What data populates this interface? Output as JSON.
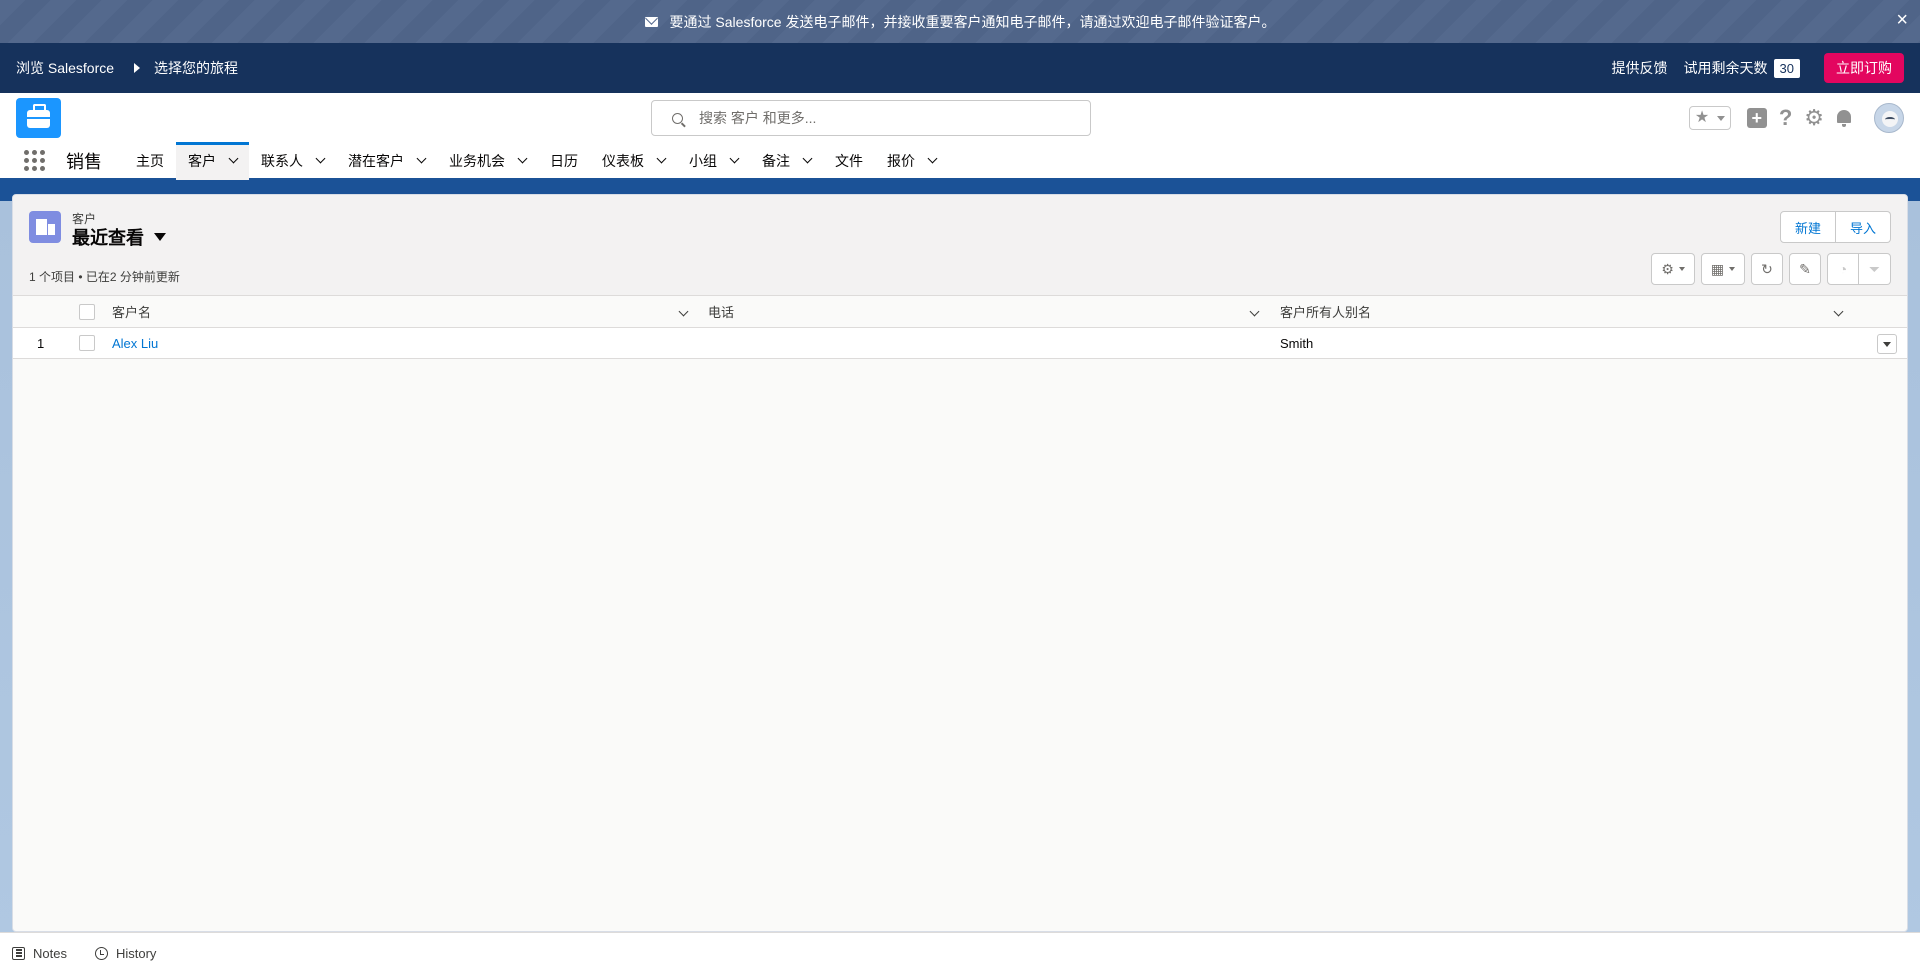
{
  "banner": {
    "message": "要通过 Salesforce 发送电子邮件，并接收重要客户通知电子邮件，请通过欢迎电子邮件验证客户。",
    "close_icon": "×"
  },
  "trialbar": {
    "explore": "浏览 Salesforce",
    "journey": "选择您的旅程",
    "feedback": "提供反馈",
    "days_label": "试用剩余天数",
    "days_value": "30",
    "buy": "立即订购"
  },
  "header": {
    "search_placeholder": "搜索 客户 和更多..."
  },
  "nav": {
    "app_name": "销售",
    "tabs": [
      {
        "label": "主页",
        "dropdown": false
      },
      {
        "label": "客户",
        "dropdown": true,
        "active": true
      },
      {
        "label": "联系人",
        "dropdown": true
      },
      {
        "label": "潜在客户",
        "dropdown": true
      },
      {
        "label": "业务机会",
        "dropdown": true
      },
      {
        "label": "日历",
        "dropdown": false
      },
      {
        "label": "仪表板",
        "dropdown": true
      },
      {
        "label": "小组",
        "dropdown": true
      },
      {
        "label": "备注",
        "dropdown": true
      },
      {
        "label": "文件",
        "dropdown": false
      },
      {
        "label": "报价",
        "dropdown": true
      }
    ]
  },
  "listview": {
    "object_label": "客户",
    "view_name": "最近查看",
    "meta": "1 个项目 • 已在2 分钟前更新",
    "new_button": "新建",
    "import_button": "导入",
    "columns": [
      "客户名",
      "电话",
      "客户所有人别名"
    ],
    "rows": [
      {
        "num": "1",
        "name": "Alex Liu",
        "phone": "",
        "owner": "Smith"
      }
    ]
  },
  "utility": {
    "notes": "Notes",
    "history": "History"
  },
  "colors": {
    "brand_dark": "#16325c",
    "accent": "#0176d3",
    "buy_button": "#e3065f"
  }
}
